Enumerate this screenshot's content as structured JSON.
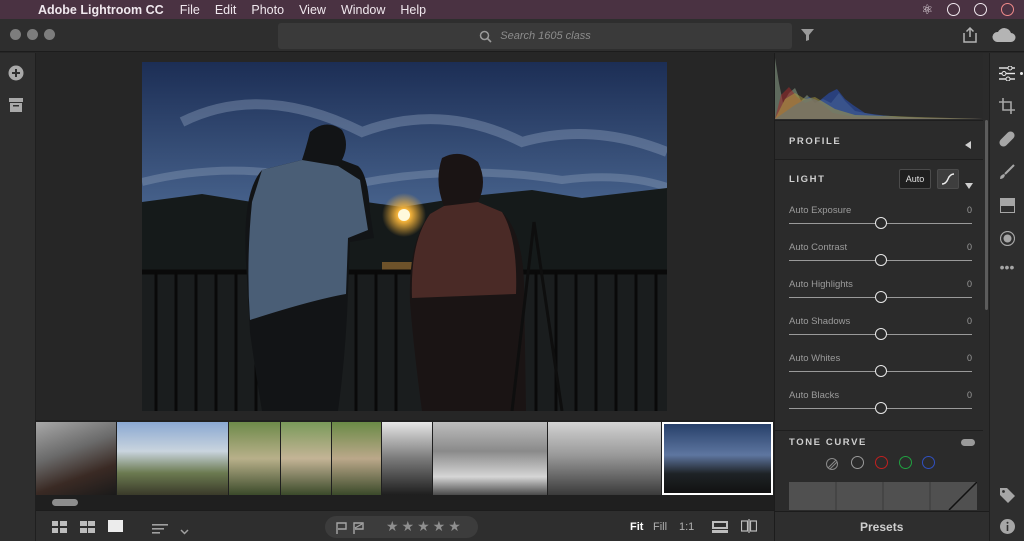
{
  "menubar": {
    "app_name": "Adobe Lightroom CC",
    "items": [
      "File",
      "Edit",
      "Photo",
      "View",
      "Window",
      "Help"
    ]
  },
  "toolbar": {
    "search_placeholder": "Search 1605 class",
    "icons": [
      "filter-icon",
      "share-icon",
      "cloud-sync-icon"
    ]
  },
  "left_rail": {
    "icons": [
      "add-photos-icon",
      "albums-icon"
    ]
  },
  "edit_panel": {
    "profile_title": "PROFILE",
    "light_title": "LIGHT",
    "auto_label": "Auto",
    "sliders": [
      {
        "label": "Auto Exposure",
        "value": "0",
        "level": 0.5
      },
      {
        "label": "Auto Contrast",
        "value": "0",
        "level": 0.5
      },
      {
        "label": "Auto Highlights",
        "value": "0",
        "level": 0.5
      },
      {
        "label": "Auto Shadows",
        "value": "0",
        "level": 0.5
      },
      {
        "label": "Auto Whites",
        "value": "0",
        "level": 0.5
      },
      {
        "label": "Auto Blacks",
        "value": "0",
        "level": 0.5
      }
    ],
    "tone_curve_title": "TONE CURVE",
    "channel_colors": [
      "#9a9a9a",
      "#c02020",
      "#20a040",
      "#3050c0"
    ],
    "presets_label": "Presets"
  },
  "right_rail": {
    "icons": [
      "edit-sliders-icon",
      "crop-icon",
      "healing-icon",
      "brush-icon",
      "linear-gradient-icon",
      "radial-gradient-icon",
      "more-icon",
      "tag-icon",
      "info-icon"
    ]
  },
  "bottom_bar": {
    "view_icons": [
      "grid-large-icon",
      "grid-small-icon",
      "single-view-icon"
    ],
    "sort_icon": "sort-icon",
    "rating_stars": 5,
    "fit_label": "Fit",
    "fill_label": "Fill",
    "one_to_one_label": "1:1"
  },
  "filmstrip": {
    "selected_index": 8,
    "count": 9
  },
  "colors": {
    "menubar": "#4a3242",
    "panel": "#2b2b2b",
    "accent_white": "#ffffff"
  }
}
